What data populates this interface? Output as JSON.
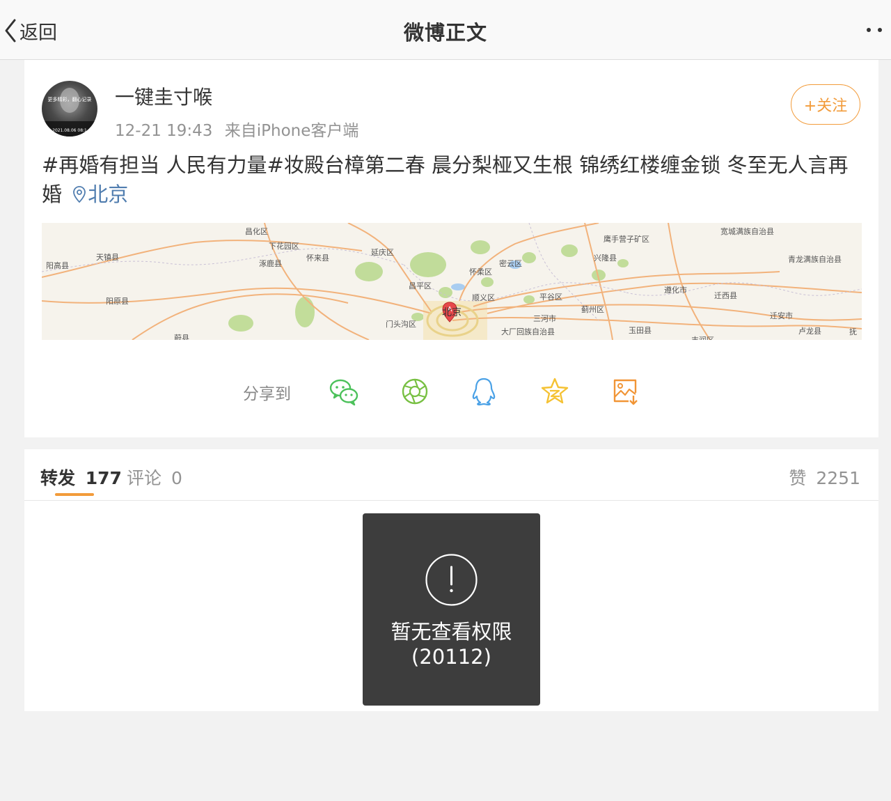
{
  "nav": {
    "back_label": "返回",
    "title": "微博正文"
  },
  "post": {
    "username": "一键圭寸喉",
    "time": "12-21 19:43",
    "source": "来自iPhone客户端",
    "follow_label": "+关注",
    "avatar_text": [
      "更多精彩，翻心记录",
      "2021.08.06 08:1"
    ],
    "text": "#再婚有担当 人民有力量#妆殿台樟第二春 晨分梨桠又生根 锦绣红楼缠金锁 冬至无人言再婚",
    "location": "北京"
  },
  "map": {
    "marker_label": "A",
    "center_label": "北京",
    "place_labels": [
      "昌化区",
      "下花园区",
      "怀来县",
      "延庆区",
      "鹰手营子矿区",
      "宽城满族自治县",
      "青龙满族自治县",
      "阳高县",
      "天镇县",
      "涿鹿县",
      "怀柔区",
      "密云区",
      "兴隆县",
      "昌平区",
      "顺义区",
      "平谷区",
      "遵化市",
      "迁西县",
      "阳原县",
      "三河市",
      "蓟州区",
      "迁安市",
      "门头沟区",
      "大厂回族自治县",
      "玉田县",
      "卢龙县",
      "蔚县",
      "丰润区",
      "抚"
    ]
  },
  "share": {
    "label": "分享到",
    "targets": [
      "wechat-icon",
      "moments-icon",
      "qq-icon",
      "qzone-icon",
      "save-image-icon"
    ]
  },
  "stats": {
    "repost_label": "转发",
    "repost_count": "177",
    "comment_label": "评论",
    "comment_count": "0",
    "like_label": "赞",
    "like_count": "2251"
  },
  "toast": {
    "message": "暂无查看权限",
    "code": "(20112)"
  },
  "colors": {
    "accent": "#f29b3a",
    "link": "#507daf",
    "wechat": "#4cc15b",
    "moments": "#78c043",
    "qq": "#4aa1e6",
    "qzone": "#f5c233",
    "save": "#f19536"
  }
}
